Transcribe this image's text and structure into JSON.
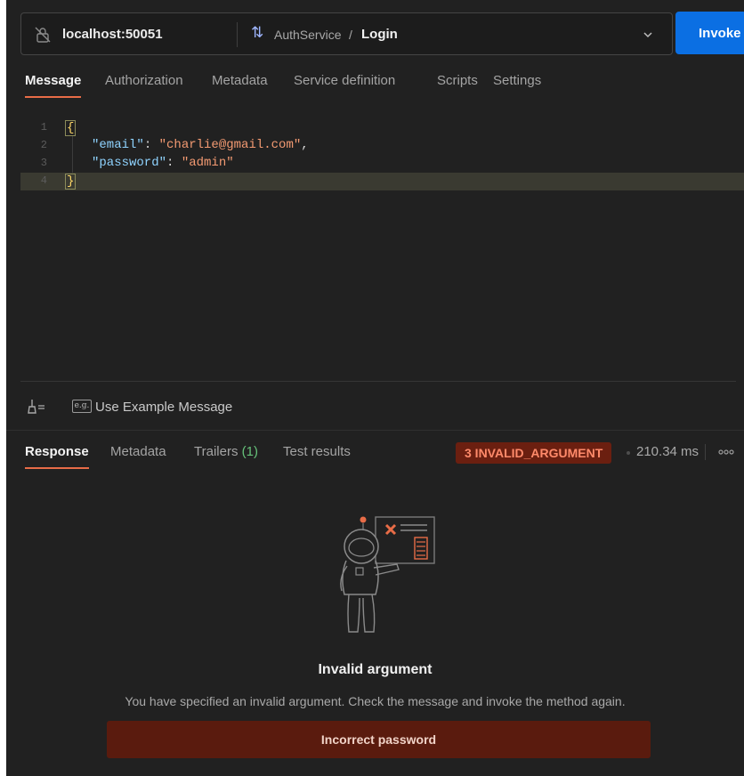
{
  "urlbar": {
    "host": "localhost:50051",
    "service": "AuthService",
    "separator": "/",
    "method": "Login",
    "invoke_label": "Invoke"
  },
  "request_tabs": [
    "Message",
    "Authorization",
    "Metadata",
    "Service definition",
    "Scripts",
    "Settings"
  ],
  "editor": {
    "line_numbers": [
      "1",
      "2",
      "3",
      "4"
    ],
    "open_brace": "{",
    "close_brace": "}",
    "email_key": "\"email\"",
    "email_value": "\"charlie@gmail.com\"",
    "password_key": "\"password\"",
    "password_value": "\"admin\""
  },
  "toolbar": {
    "example_badge": "e.g.",
    "example_label": "Use Example Message"
  },
  "response_tabs": {
    "response": "Response",
    "metadata": "Metadata",
    "trailers": "Trailers",
    "trailers_count": "(1)",
    "test_results": "Test results"
  },
  "status": {
    "code": "3 INVALID_ARGUMENT",
    "time": "210.34 ms"
  },
  "error": {
    "title": "Invalid argument",
    "description": "You have specified an invalid argument. Check the message and invoke the method again.",
    "detail": "Incorrect password"
  },
  "colors": {
    "accent": "#e86c47",
    "invoke": "#0b6fe3",
    "error_bg": "#5a1b0e"
  },
  "icons": [
    "no-tls-lock-icon",
    "method-arrows-icon",
    "chevron-down-icon",
    "broom-icon",
    "more-icon",
    "astronaut-illustration"
  ]
}
